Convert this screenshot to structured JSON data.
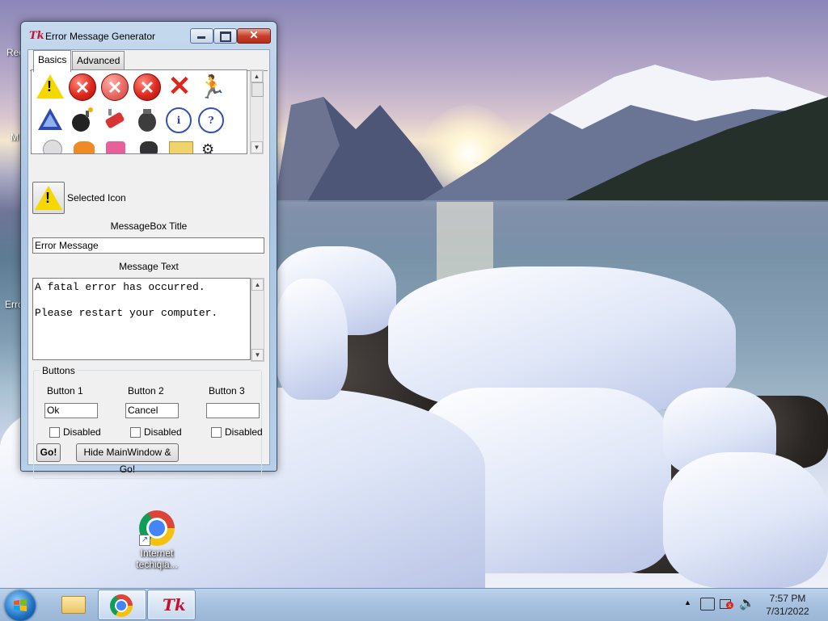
{
  "desktop": {
    "icons": [
      {
        "label_line1": "Internet",
        "label_line2": "techiqia..."
      }
    ],
    "left_edge_labels": [
      "Rec",
      "M",
      "Erro"
    ]
  },
  "window": {
    "title": "Error Message Generator",
    "app_logo": "Tk",
    "tabs": [
      {
        "label": "Basics",
        "active": true
      },
      {
        "label": "Advanced",
        "active": false
      }
    ],
    "icon_grid": [
      "warning-icon",
      "error-x-icon",
      "error-x-gray-icon",
      "error-x-icon",
      "red-x-icon",
      "running-man-icon",
      "triangle-icon",
      "bomb-icon",
      "dynamite-icon",
      "grenade-icon",
      "info-icon",
      "help-icon"
    ],
    "selected_icon_label": "Selected Icon",
    "messagebox_title_label": "MessageBox Title",
    "messagebox_title_value": "Error Message",
    "message_text_label": "Message Text",
    "message_text_value": "A fatal error has occurred.\n\nPlease restart your computer.",
    "buttons_group_label": "Buttons",
    "buttons": [
      {
        "label": "Button 1",
        "value": "Ok",
        "disabled_label": "Disabled",
        "disabled": false
      },
      {
        "label": "Button 2",
        "value": "Cancel",
        "disabled_label": "Disabled",
        "disabled": false
      },
      {
        "label": "Button 3",
        "value": "",
        "disabled_label": "Disabled",
        "disabled": false
      }
    ],
    "go_button": "Go!",
    "hide_go_button": "Hide MainWindow & Go!"
  },
  "taskbar": {
    "clock_time": "7:57 PM",
    "clock_date": "7/31/2022",
    "tk_label": "Tk"
  },
  "colors": {
    "accent": "#c8102e",
    "window_frame": "#a9c4e2",
    "taskbar": "#a7c1df"
  }
}
